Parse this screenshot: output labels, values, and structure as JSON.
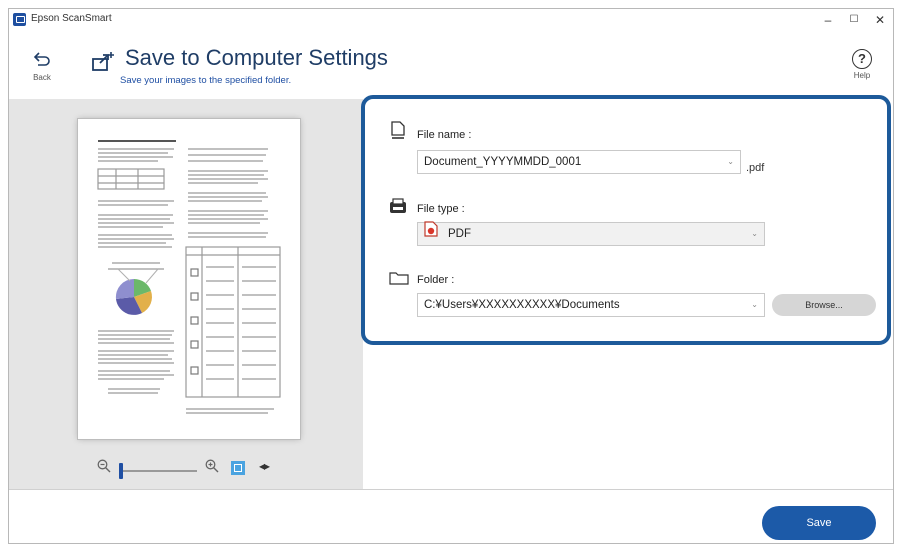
{
  "window": {
    "title": "Epson ScanSmart",
    "minimize": "–",
    "maximize": "☐",
    "close": "✕"
  },
  "header": {
    "back_label": "Back",
    "title": "Save to Computer Settings",
    "subtitle": "Save your images to the specified folder.",
    "help_label": "Help"
  },
  "settings": {
    "file_name": {
      "label": "File name :",
      "value": "Document_YYYYMMDD_0001",
      "extension": ".pdf"
    },
    "file_type": {
      "label": "File type :",
      "value": "PDF"
    },
    "folder": {
      "label": "Folder :",
      "value": "C:¥Users¥XXXXXXXXXX¥Documents",
      "browse_label": "Browse..."
    }
  },
  "footer": {
    "save_label": "Save"
  },
  "colors": {
    "accent": "#1d5a9a",
    "save_button": "#1c5aa8",
    "title": "#1f3d66"
  },
  "icons": [
    "back-arrow-icon",
    "save-to-computer-icon",
    "help-icon",
    "document-icon",
    "file-type-icon",
    "pdf-icon",
    "folder-icon",
    "zoom-out-icon",
    "zoom-in-icon",
    "fit-to-window-icon",
    "expand-arrows-icon"
  ]
}
